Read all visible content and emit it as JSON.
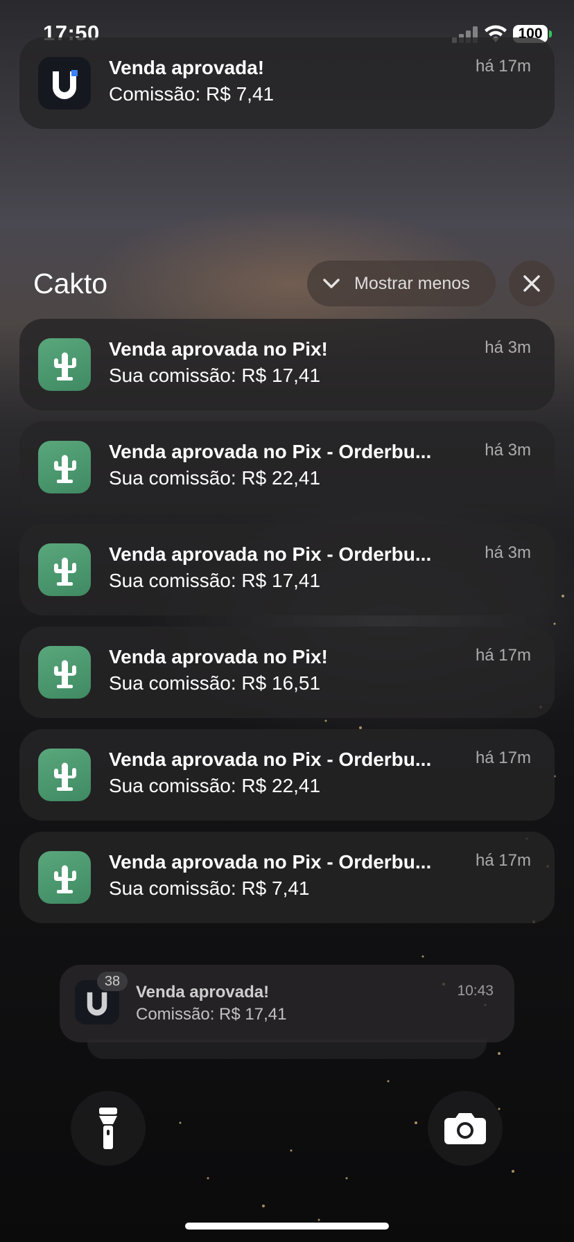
{
  "status_bar": {
    "time": "17:50",
    "battery": "100"
  },
  "top_notification": {
    "app": "u-app",
    "title": "Venda aprovada!",
    "body": "Comissão: R$ 7,41",
    "time": "há 17m"
  },
  "group": {
    "title": "Cakto",
    "show_less_label": "Mostrar menos",
    "notifications": [
      {
        "title": "Venda aprovada no Pix!",
        "body": "Sua comissão: R$ 17,41",
        "time": "há 3m"
      },
      {
        "title": "Venda aprovada no Pix - Orderbu...",
        "body": "Sua comissão: R$ 22,41",
        "time": "há 3m"
      },
      {
        "title": "Venda aprovada no Pix - Orderbu...",
        "body": "Sua comissão: R$ 17,41",
        "time": "há 3m"
      },
      {
        "title": "Venda aprovada no Pix!",
        "body": "Sua comissão: R$ 16,51",
        "time": "há 17m"
      },
      {
        "title": "Venda aprovada no Pix - Orderbu...",
        "body": "Sua comissão: R$ 22,41",
        "time": "há 17m"
      },
      {
        "title": "Venda aprovada no Pix - Orderbu...",
        "body": "Sua comissão: R$ 7,41",
        "time": "há 17m"
      }
    ]
  },
  "stacked_notification": {
    "badge": "38",
    "title": "Venda aprovada!",
    "body": "Comissão: R$ 17,41",
    "time": "10:43"
  },
  "icons": {
    "cakto_app": "cactus-icon",
    "u_app": "u-logo-icon",
    "flashlight": "flashlight-icon",
    "camera": "camera-icon"
  },
  "colors": {
    "cakto_icon": "#4f9c72",
    "card_background": "#262426",
    "battery_charge": "#35c759"
  }
}
